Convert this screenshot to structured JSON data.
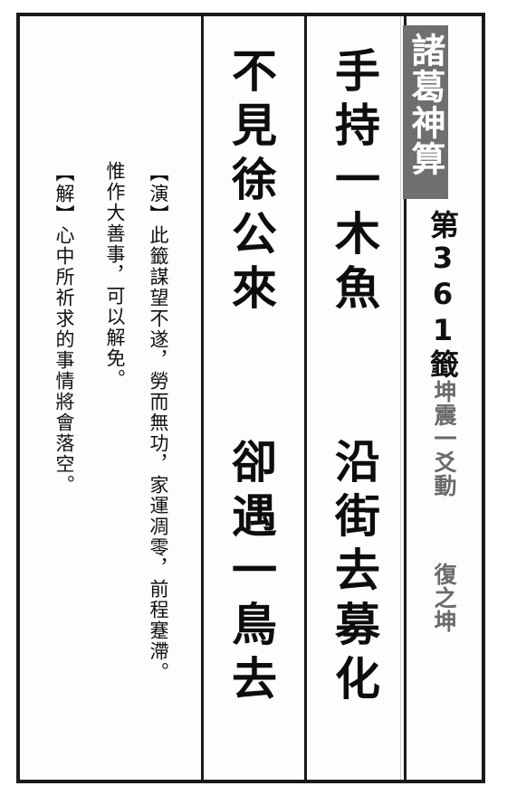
{
  "header": {
    "title": "諸葛神算",
    "number": "第361籤",
    "gua": "坤震一爻動",
    "gua_result": "復之坤"
  },
  "poem": {
    "line1_top": "手持一木魚",
    "line1_bottom": "沿街去募化",
    "line2_top": "不見徐公來",
    "line2_bottom": "卻遇一鳥去"
  },
  "notes": {
    "explain_line1": "【演】此籤謀望不遂，勞而無功，家運凋零，前程蹇滯。",
    "explain_line2": "惟作大善事，可以解免。",
    "interpret": "【解】心中所祈求的事情將會落空。"
  }
}
